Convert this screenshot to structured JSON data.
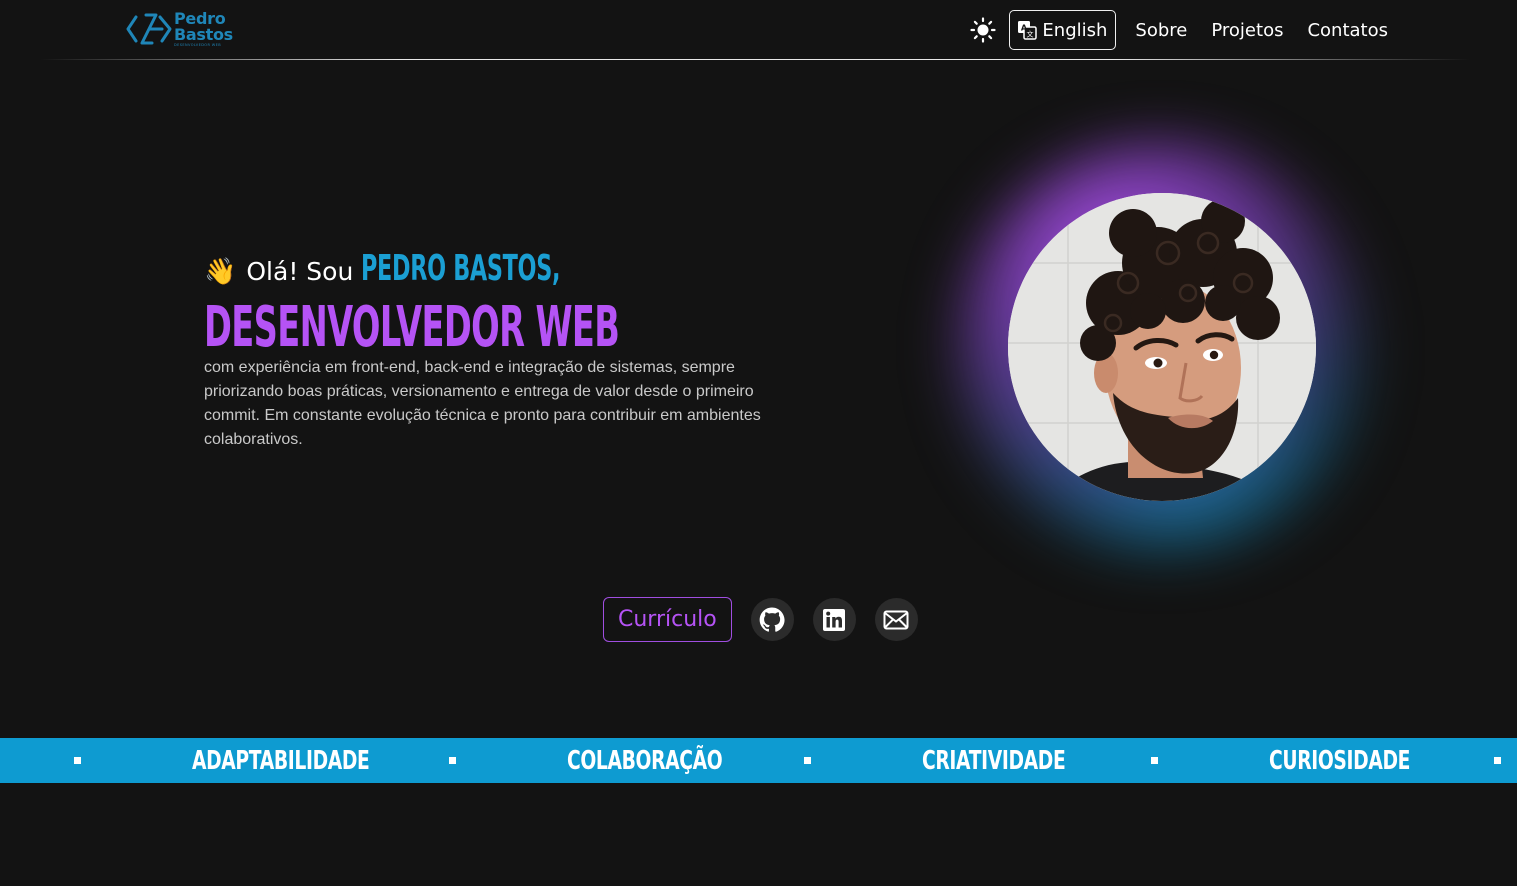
{
  "header": {
    "logo": {
      "name_line1": "Pedro",
      "name_line2": "Bastos",
      "tagline": "DESENVOLVEDOR WEB"
    },
    "theme_icon": "sun-icon",
    "language_button": "English",
    "nav": [
      "Sobre",
      "Projetos",
      "Contatos"
    ]
  },
  "hero": {
    "wave_emoji": "👋",
    "greeting": "Olá! Sou",
    "name": "PEDRO BASTOS,",
    "role": "DESENVOLVEDOR WEB",
    "description": "com experiência em front-end, back-end e integração de sistemas, sempre priorizando boas práticas, versionamento e entrega de valor desde o primeiro commit. Em constante evolução técnica e pronto para contribuir em ambientes colaborativos."
  },
  "actions": {
    "resume_button": "Currículo",
    "socials": [
      "github-icon",
      "linkedin-icon",
      "mail-icon"
    ]
  },
  "marquee": {
    "words": [
      "ADAPTABILIDADE",
      "COLABORAÇÃO",
      "CRIATIVIDADE",
      "CURIOSIDADE"
    ]
  },
  "colors": {
    "background": "#131313",
    "accent_blue": "#0e9bd1",
    "accent_purple": "#b553f5"
  }
}
